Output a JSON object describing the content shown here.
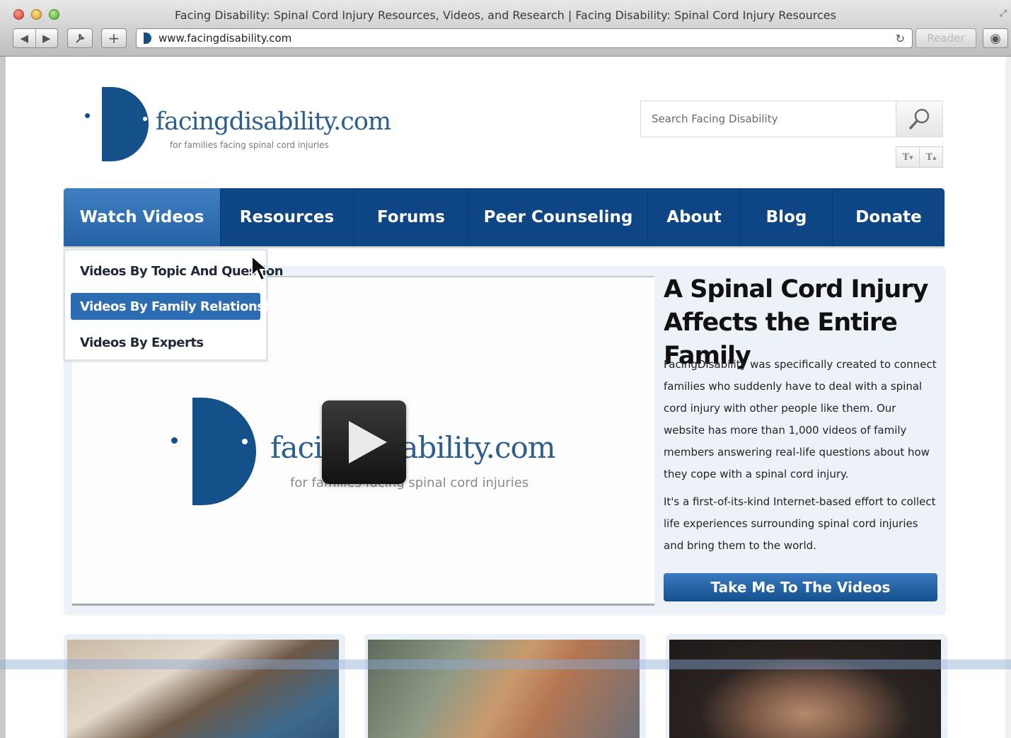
{
  "browser": {
    "title": "Facing Disability: Spinal Cord Injury Resources, Videos, and Research | Facing Disability: Spinal Cord Injury Resources",
    "url": "www.facingdisability.com",
    "reader_label": "Reader",
    "plus_label": "+",
    "back_label": "◀",
    "forward_label": "▶"
  },
  "header": {
    "logo_text": "facingdisability.com",
    "logo_tagline": "for families facing spinal cord injuries",
    "search_placeholder": "Search Facing Disability",
    "text_smaller": "T",
    "text_larger": "T"
  },
  "nav": {
    "items": [
      {
        "label": "Watch Videos"
      },
      {
        "label": "Resources"
      },
      {
        "label": "Forums"
      },
      {
        "label": "Peer Counseling"
      },
      {
        "label": "About"
      },
      {
        "label": "Blog"
      },
      {
        "label": "Donate"
      }
    ]
  },
  "dropdown": {
    "items": [
      {
        "label": "Videos By Topic And Question"
      },
      {
        "label": "Videos By Family Relationship"
      },
      {
        "label": "Videos By Experts"
      }
    ]
  },
  "hero": {
    "video_logo_text": "facingdisability.com",
    "video_logo_tagline": "for families facing spinal cord injuries",
    "heading": "A Spinal Cord Injury Affects the Entire Family",
    "paragraph1": "FacingDisability was specifically created to connect families who suddenly have to deal with a spinal cord injury with other people like them. Our website has more than 1,000 videos of family members answering real-life questions about how they cope with a spinal cord injury.",
    "paragraph2": "It's a first-of-its-kind Internet-based effort to collect life experiences surrounding spinal cord injuries and bring them to the world.",
    "cta_label": "Take Me To The Videos"
  },
  "colors": {
    "nav_blue": "#0e4585",
    "active_blue": "#2b6cb3",
    "brand_blue": "#14508a"
  }
}
